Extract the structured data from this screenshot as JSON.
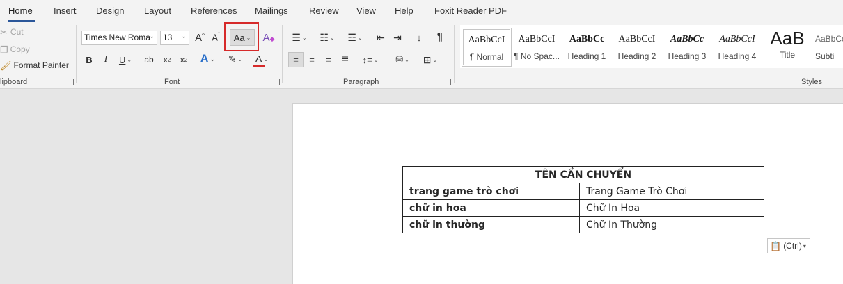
{
  "tabs": [
    {
      "label": "Home",
      "active": true
    },
    {
      "label": "Insert"
    },
    {
      "label": "Design"
    },
    {
      "label": "Layout"
    },
    {
      "label": "References"
    },
    {
      "label": "Mailings"
    },
    {
      "label": "Review"
    },
    {
      "label": "View"
    },
    {
      "label": "Help"
    },
    {
      "label": "Foxit Reader PDF"
    }
  ],
  "clipboard": {
    "cut": "Cut",
    "copy": "Copy",
    "format_painter": "Format Painter",
    "group_label": "lipboard"
  },
  "font": {
    "name": "Times New Roma",
    "size": "13",
    "change_case_label": "Aa",
    "bold": "B",
    "italic": "I",
    "underline": "U",
    "strike": "ab",
    "subscript": "x",
    "superscript": "x",
    "group_label": "Font",
    "font_color": "#d62a2a"
  },
  "paragraph": {
    "group_label": "Paragraph",
    "pilcrow": "¶"
  },
  "styles": {
    "group_label": "Styles",
    "items": [
      {
        "preview": "AaBbCcI",
        "name": "¶ Normal"
      },
      {
        "preview": "AaBbCcI",
        "name": "¶ No Spac..."
      },
      {
        "preview": "AaBbCc",
        "name": "Heading 1"
      },
      {
        "preview": "AaBbCcI",
        "name": "Heading 2"
      },
      {
        "preview": "AaBbCc",
        "name": "Heading 3"
      },
      {
        "preview": "AaBbCcI",
        "name": "Heading 4"
      },
      {
        "preview": "AaB",
        "name": "Title"
      },
      {
        "preview": "AaBbCc",
        "name": "Subti"
      }
    ]
  },
  "document": {
    "table_header": "TÊN CẦN CHUYỂN",
    "rows": [
      {
        "label": "trang game trò chơi",
        "value": "Trang Game Trò Chơi"
      },
      {
        "label": "chữ in hoa",
        "value": "Chữ In Hoa"
      },
      {
        "label": "chữ in thường",
        "value": "Chữ In Thường"
      }
    ],
    "paste_options": "(Ctrl)"
  },
  "colors": {
    "accent": "#2b579a",
    "highlight_box": "#d62a2a"
  }
}
